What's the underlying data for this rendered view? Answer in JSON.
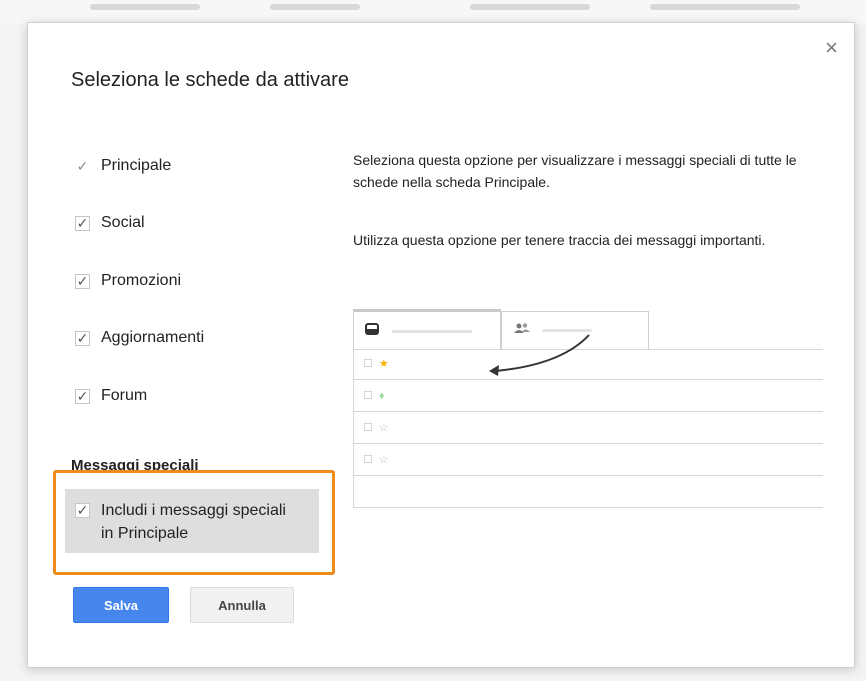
{
  "dialog": {
    "title": "Seleziona le schede da attivare",
    "close_icon": "close-icon"
  },
  "tabs": [
    {
      "label": "Principale",
      "checked": true,
      "editable": false
    },
    {
      "label": "Social",
      "checked": true,
      "editable": true
    },
    {
      "label": "Promozioni",
      "checked": true,
      "editable": true
    },
    {
      "label": "Aggiornamenti",
      "checked": true,
      "editable": true
    },
    {
      "label": "Forum",
      "checked": true,
      "editable": true
    }
  ],
  "special": {
    "section_title": "Messaggi speciali",
    "option_line1": "Includi i messaggi speciali",
    "option_line2": "in Principale",
    "checked": true
  },
  "description": {
    "para1": "Seleziona questa opzione per visualizzare i messaggi speciali di tutte le schede nella scheda Principale.",
    "para2": "Utilizza questa opzione per tenere traccia dei messaggi importanti."
  },
  "buttons": {
    "save": "Salva",
    "cancel": "Annulla"
  },
  "colors": {
    "primary_button": "#4787ed",
    "highlight_frame": "#f08a1a",
    "star": "#f4b400"
  },
  "icons": {
    "inbox": "inbox-icon",
    "social": "people-icon",
    "arrow": "curved-arrow-icon"
  }
}
